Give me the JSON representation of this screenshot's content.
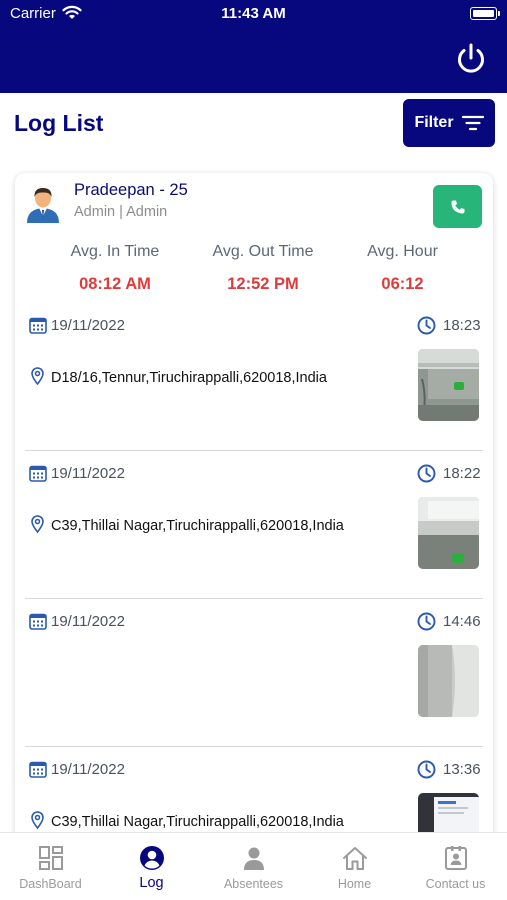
{
  "status_bar": {
    "carrier": "Carrier",
    "time": "11:43 AM"
  },
  "header": {
    "title": "Log List",
    "filter_label": "Filter"
  },
  "profile": {
    "name": "Pradeepan - 25",
    "role": "Admin | Admin"
  },
  "stats": [
    {
      "label": "Avg. In Time",
      "value": "08:12 AM"
    },
    {
      "label": "Avg. Out Time",
      "value": "12:52 PM"
    },
    {
      "label": "Avg. Hour",
      "value": "06:12"
    }
  ],
  "logs": [
    {
      "date": "19/11/2022",
      "time": "18:23",
      "address": "D18/16,Tennur,Tiruchirappalli,620018,India"
    },
    {
      "date": "19/11/2022",
      "time": "18:22",
      "address": "C39,Thillai Nagar,Tiruchirappalli,620018,India"
    },
    {
      "date": "19/11/2022",
      "time": "14:46",
      "address": ""
    },
    {
      "date": "19/11/2022",
      "time": "13:36",
      "address": "C39,Thillai Nagar,Tiruchirappalli,620018,India"
    }
  ],
  "tabs": [
    {
      "label": "DashBoard",
      "icon": "dashboard-icon",
      "active": false
    },
    {
      "label": "Log",
      "icon": "user-circle-icon",
      "active": true
    },
    {
      "label": "Absentees",
      "icon": "person-icon",
      "active": false
    },
    {
      "label": "Home",
      "icon": "home-icon",
      "active": false
    },
    {
      "label": "Contact us",
      "icon": "contact-card-icon",
      "active": false
    }
  ],
  "colors": {
    "primary": "#07087e",
    "accent_red": "#e03b3b",
    "call_green": "#27b57a",
    "inactive_gray": "#9a9a9a"
  }
}
